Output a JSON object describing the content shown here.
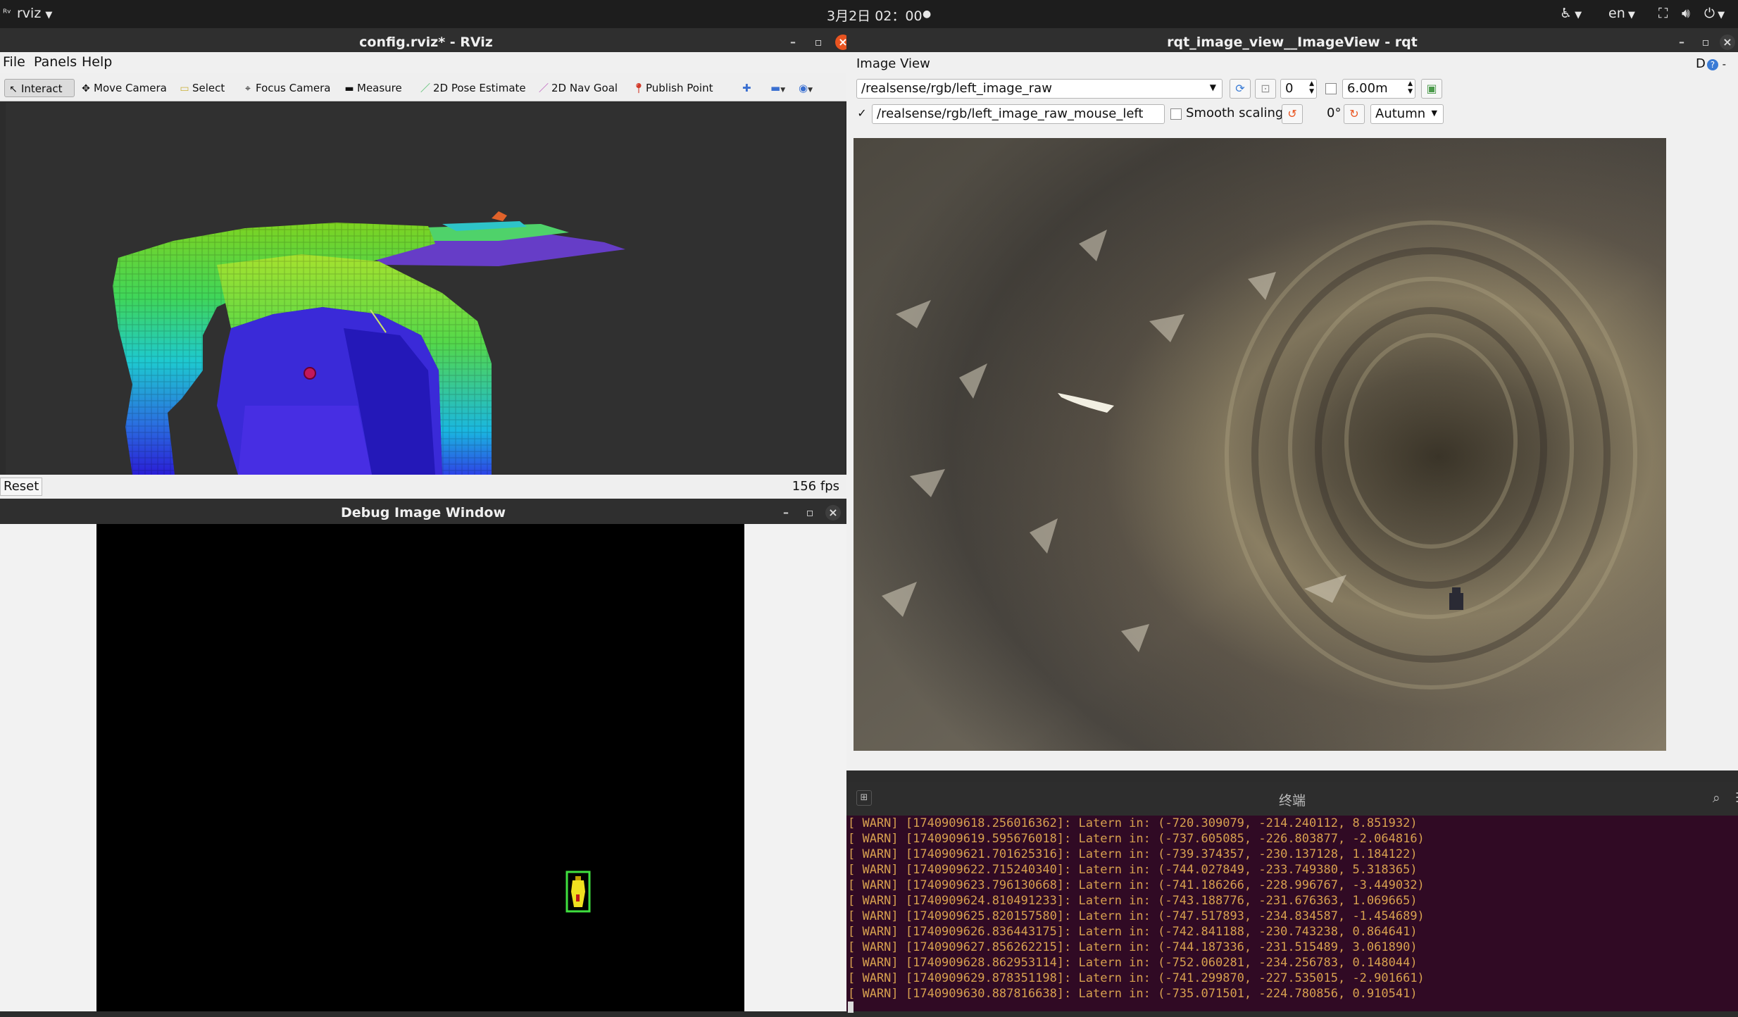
{
  "topbar": {
    "app_menu": "rviz",
    "clock": "3月2日 02：00",
    "language": "en"
  },
  "rviz": {
    "title": "config.rviz* - RViz",
    "menu": [
      "File",
      "Panels",
      "Help"
    ],
    "tools": [
      "Interact",
      "Move Camera",
      "Select",
      "Focus Camera",
      "Measure",
      "2D Pose Estimate",
      "2D Nav Goal",
      "Publish Point"
    ],
    "reset_label": "Reset",
    "fps": "156 fps"
  },
  "debug_window": {
    "title": "Debug Image Window"
  },
  "rqt": {
    "title": "rqt_image_view__ImageView - rqt",
    "plugin_label": "Image View",
    "dock_label": "D",
    "topic": "/realsense/rgb/left_image_raw",
    "spin_value": "0",
    "range_value": "6.00m",
    "mouse_topic": "/realsense/rgb/left_image_raw_mouse_left",
    "smooth_scaling_label": "Smooth scaling",
    "rotation": "0°",
    "colormap": "Autumn"
  },
  "terminal": {
    "title": "终端",
    "lines": [
      "[ WARN] [1740909618.256016362]: Latern in: (-720.309079, -214.240112, 8.851932)",
      "[ WARN] [1740909619.595676018]: Latern in: (-737.605085, -226.803877, -2.064816)",
      "[ WARN] [1740909621.701625316]: Latern in: (-739.374357, -230.137128, 1.184122)",
      "[ WARN] [1740909622.715240340]: Latern in: (-744.027849, -233.749380, 5.318365)",
      "[ WARN] [1740909623.796130668]: Latern in: (-741.186266, -228.996767, -3.449032)",
      "[ WARN] [1740909624.810491233]: Latern in: (-743.188776, -231.676363, 1.069665)",
      "[ WARN] [1740909625.820157580]: Latern in: (-747.517893, -234.834587, -1.454689)",
      "[ WARN] [1740909626.836443175]: Latern in: (-742.841188, -230.743238, 0.864641)",
      "[ WARN] [1740909627.856262215]: Latern in: (-744.187336, -231.515489, 3.061890)",
      "[ WARN] [1740909628.862953114]: Latern in: (-752.060281, -234.256783, 0.148044)",
      "[ WARN] [1740909629.878351198]: Latern in: (-741.299870, -227.535015, -2.901661)",
      "[ WARN] [1740909630.887816638]: Latern in: (-735.071501, -224.780856, 0.910541)"
    ]
  },
  "colors": {
    "accent": "#e95420",
    "terminal_bg": "#300a24",
    "terminal_text": "#d7a04f"
  }
}
